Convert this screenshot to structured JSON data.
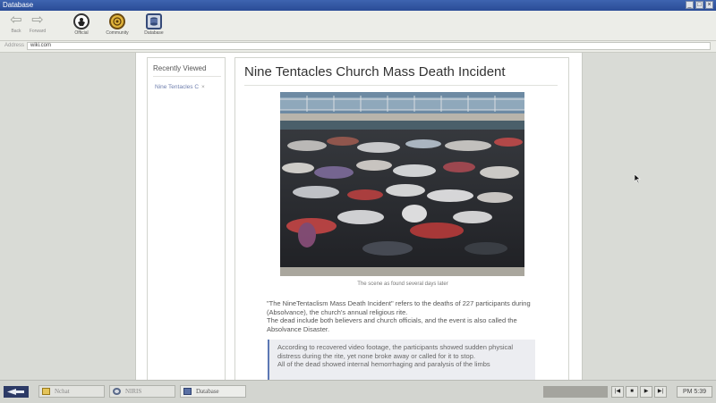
{
  "window": {
    "title": "Database"
  },
  "toolbar": {
    "back_label": "Back",
    "forward_label": "Forward",
    "buttons": [
      {
        "label": "Official",
        "icon": "official-emblem-icon"
      },
      {
        "label": "Community",
        "icon": "community-emblem-icon"
      },
      {
        "label": "Database",
        "icon": "database-icon"
      }
    ]
  },
  "address": {
    "label": "Address",
    "value": "wiki.com"
  },
  "sidebar": {
    "heading": "Recently Viewed",
    "items": [
      {
        "label": "Nine Tentacles C",
        "close": "×"
      }
    ]
  },
  "article": {
    "title": "Nine Tentacles Church Mass Death Incident",
    "image_caption": "The scene as found several days later",
    "paragraphs": [
      "\"The NineTentaclism Mass Death Incident\" refers to the deaths of 227 participants during (Absolvance), the church's annual religious rite.",
      "The dead include both believers and church officials, and the event is also called the Absolvance Disaster."
    ],
    "quote": [
      "According to recovered video footage, the participants showed sudden physical distress during the rite, yet none broke away or called for it to stop.",
      "All of the dead showed internal hemorrhaging and paralysis of the limbs"
    ]
  },
  "taskbar": {
    "tasks": [
      {
        "label": "Nchat",
        "active": false
      },
      {
        "label": "NIRIS",
        "active": false
      },
      {
        "label": "Database",
        "active": true
      }
    ],
    "clock": "PM 5:39",
    "media_progress": 0
  }
}
